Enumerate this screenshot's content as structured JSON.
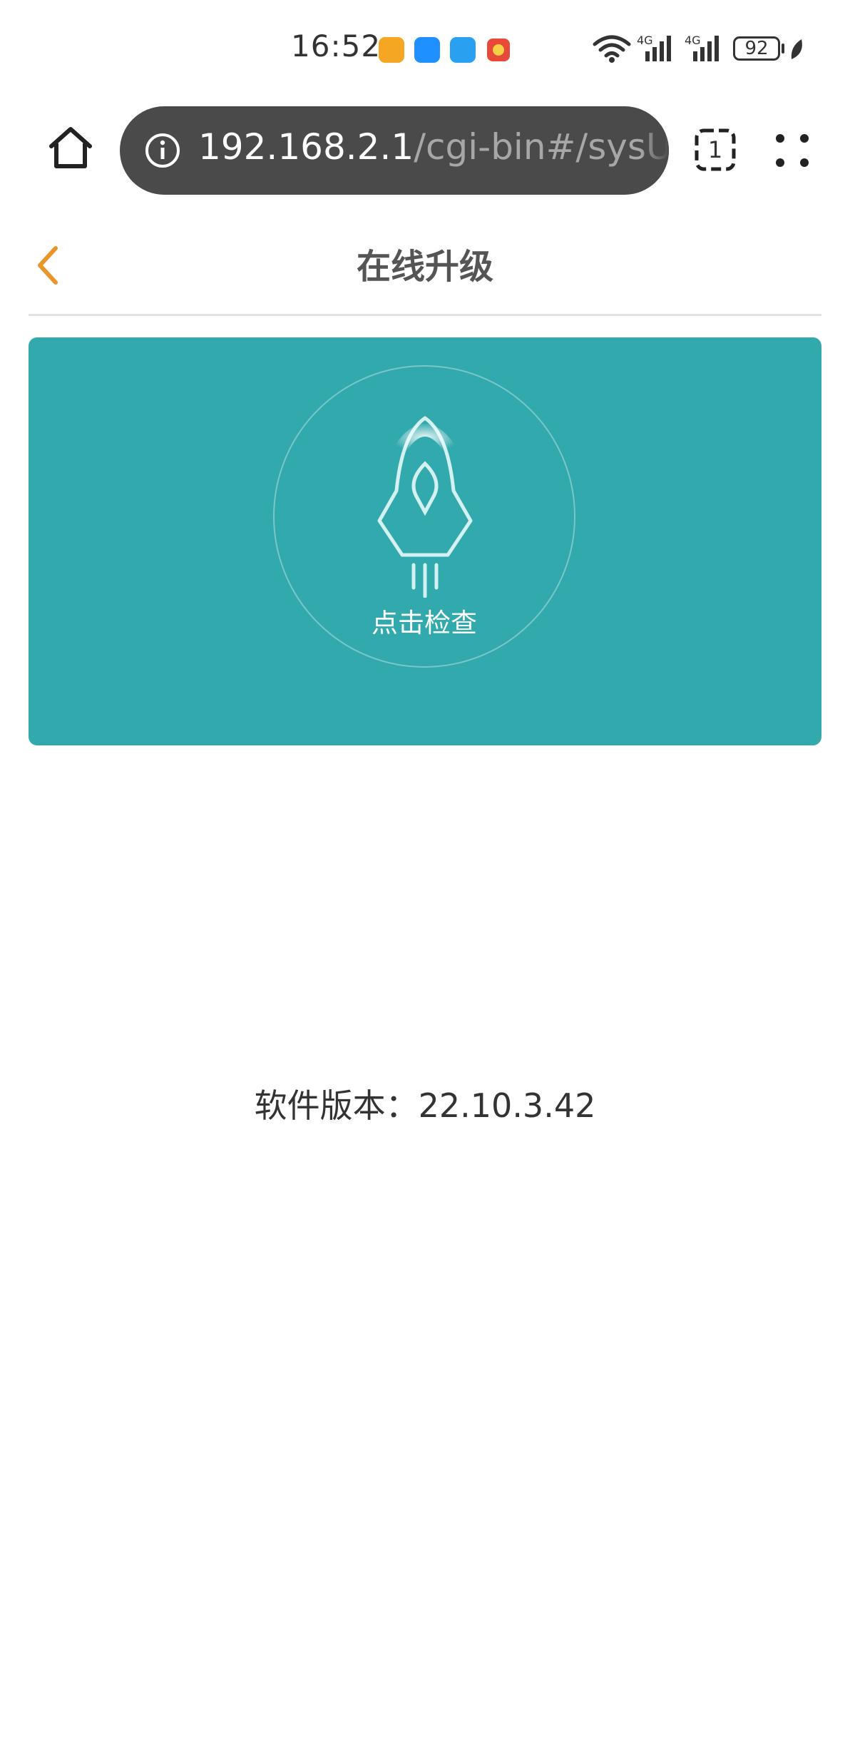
{
  "status_bar": {
    "time": "16:52",
    "battery": "92",
    "icons": [
      "wifi-icon",
      "signal-4g-icon",
      "signal-4g-icon",
      "battery-icon",
      "leaf-icon"
    ],
    "notification_icons": [
      "app-notification-icon",
      "message-icon",
      "cloud-icon",
      "app-icon"
    ]
  },
  "browser": {
    "url_host": "192.168.2.1",
    "url_path": "/cgi-bin#/sysUpg",
    "tab_count": "1",
    "icons": [
      "home-icon",
      "info-icon",
      "tabs-icon",
      "menu-dots-icon"
    ]
  },
  "page": {
    "title": "在线升级",
    "back_icon": "chevron-left-icon",
    "check_label": "点击检查",
    "rocket_icon": "rocket-icon",
    "version_text": "软件版本：22.10.3.42"
  },
  "colors": {
    "accent": "#e8952a",
    "card": "#31a9ad",
    "url_bar": "#4a4a4a"
  }
}
